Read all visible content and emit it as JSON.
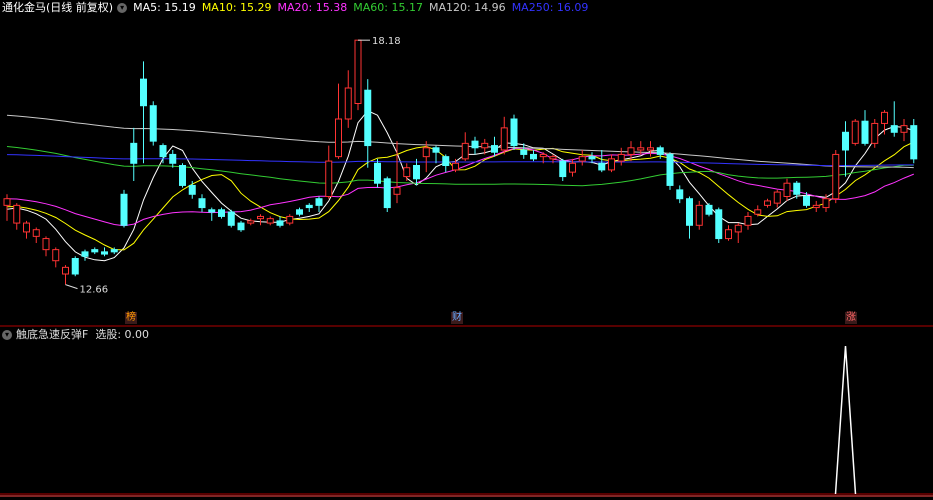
{
  "header": {
    "title": "通化金马(日线 前复权)",
    "ma_items": [
      {
        "label": "MA5: 15.19",
        "color": "#ffffff"
      },
      {
        "label": "MA10: 15.29",
        "color": "#ffff00"
      },
      {
        "label": "MA20: 15.38",
        "color": "#ff33ff"
      },
      {
        "label": "MA60: 15.17",
        "color": "#33cc33"
      },
      {
        "label": "MA120: 14.96",
        "color": "#c8c8c8"
      },
      {
        "label": "MA250: 16.09",
        "color": "#3333ff"
      }
    ]
  },
  "sub_panel": {
    "title": "触底急速反弹F",
    "value_label": "选股: 0.00"
  },
  "annotations": {
    "high_label": "18.18",
    "low_label": "12.66"
  },
  "tags": [
    {
      "text": "榜",
      "color": "#ff9900"
    },
    {
      "text": "财",
      "color": "#66aaff"
    },
    {
      "text": "涨",
      "color": "#ff6666"
    }
  ],
  "colors": {
    "up": "#ff3333",
    "down": "#54ffff",
    "border": "#b00000"
  },
  "chart_data": {
    "type": "candlestick",
    "price_range": [
      12.2,
      18.5
    ],
    "candles": [
      [
        14.45,
        14.6,
        14.1,
        14.7
      ],
      [
        14.05,
        14.45,
        13.9,
        14.5
      ],
      [
        13.85,
        14.05,
        13.7,
        14.1
      ],
      [
        13.75,
        13.9,
        13.6,
        13.95
      ],
      [
        13.45,
        13.7,
        13.3,
        13.75
      ],
      [
        13.2,
        13.45,
        13.05,
        13.5
      ],
      [
        12.9,
        13.05,
        12.66,
        13.1
      ],
      [
        13.25,
        12.9,
        12.85,
        13.3
      ],
      [
        13.4,
        13.3,
        13.2,
        13.45
      ],
      [
        13.45,
        13.4,
        13.35,
        13.5
      ],
      [
        13.4,
        13.35,
        13.3,
        13.5
      ],
      [
        13.45,
        13.4,
        13.35,
        13.5
      ],
      [
        14.7,
        14.0,
        13.95,
        14.8
      ],
      [
        15.85,
        15.4,
        15.0,
        16.2
      ],
      [
        17.3,
        16.7,
        15.4,
        17.7
      ],
      [
        16.7,
        15.9,
        15.8,
        16.8
      ],
      [
        15.8,
        15.55,
        15.4,
        15.85
      ],
      [
        15.6,
        15.4,
        15.3,
        15.7
      ],
      [
        15.35,
        14.9,
        14.85,
        15.4
      ],
      [
        14.9,
        14.7,
        14.6,
        15.0
      ],
      [
        14.6,
        14.4,
        14.3,
        14.7
      ],
      [
        14.35,
        14.3,
        14.1,
        14.4
      ],
      [
        14.35,
        14.2,
        14.15,
        14.4
      ],
      [
        14.3,
        14.0,
        13.95,
        14.35
      ],
      [
        14.05,
        13.9,
        13.85,
        14.1
      ],
      [
        14.05,
        14.1,
        14.0,
        14.15
      ],
      [
        14.15,
        14.2,
        14.0,
        14.25
      ],
      [
        14.05,
        14.15,
        14.0,
        14.2
      ],
      [
        14.1,
        14.0,
        13.95,
        14.2
      ],
      [
        14.05,
        14.2,
        14.0,
        14.25
      ],
      [
        14.35,
        14.25,
        14.2,
        14.4
      ],
      [
        14.45,
        14.4,
        14.3,
        14.5
      ],
      [
        14.6,
        14.45,
        14.3,
        14.65
      ],
      [
        14.65,
        15.45,
        14.6,
        15.8
      ],
      [
        15.55,
        16.4,
        15.5,
        17.2
      ],
      [
        16.4,
        17.1,
        16.2,
        17.5
      ],
      [
        16.75,
        18.18,
        16.6,
        18.18
      ],
      [
        17.05,
        15.8,
        15.3,
        17.3
      ],
      [
        15.4,
        14.95,
        14.85,
        15.5
      ],
      [
        15.05,
        14.4,
        14.3,
        15.1
      ],
      [
        14.7,
        14.85,
        14.5,
        15.9
      ],
      [
        15.1,
        15.3,
        15.0,
        15.4
      ],
      [
        15.35,
        15.05,
        14.9,
        15.5
      ],
      [
        15.55,
        15.75,
        15.2,
        15.9
      ],
      [
        15.75,
        15.65,
        15.4,
        15.8
      ],
      [
        15.55,
        15.35,
        15.2,
        15.6
      ],
      [
        15.25,
        15.4,
        15.2,
        15.5
      ],
      [
        15.5,
        15.85,
        15.45,
        16.1
      ],
      [
        15.9,
        15.75,
        15.6,
        16.0
      ],
      [
        15.75,
        15.85,
        15.6,
        15.95
      ],
      [
        15.8,
        15.65,
        15.55,
        16.0
      ],
      [
        15.7,
        16.2,
        15.6,
        16.45
      ],
      [
        16.4,
        15.8,
        15.7,
        16.5
      ],
      [
        15.7,
        15.6,
        15.5,
        15.85
      ],
      [
        15.6,
        15.5,
        15.45,
        15.7
      ],
      [
        15.55,
        15.6,
        15.4,
        15.65
      ],
      [
        15.5,
        15.55,
        15.4,
        15.6
      ],
      [
        15.45,
        15.1,
        15.0,
        15.5
      ],
      [
        15.2,
        15.4,
        15.1,
        15.5
      ],
      [
        15.45,
        15.55,
        15.35,
        15.7
      ],
      [
        15.55,
        15.5,
        15.4,
        15.65
      ],
      [
        15.4,
        15.25,
        15.2,
        15.7
      ],
      [
        15.25,
        15.5,
        15.2,
        15.6
      ],
      [
        15.45,
        15.6,
        15.35,
        15.75
      ],
      [
        15.6,
        15.75,
        15.45,
        15.9
      ],
      [
        15.7,
        15.75,
        15.6,
        15.9
      ],
      [
        15.7,
        15.75,
        15.55,
        15.9
      ],
      [
        15.75,
        15.6,
        15.5,
        15.8
      ],
      [
        15.6,
        14.9,
        14.8,
        15.65
      ],
      [
        14.8,
        14.6,
        14.5,
        14.9
      ],
      [
        14.6,
        14.0,
        13.7,
        14.65
      ],
      [
        14.0,
        14.45,
        13.9,
        14.55
      ],
      [
        14.45,
        14.25,
        14.2,
        14.5
      ],
      [
        14.35,
        13.7,
        13.6,
        14.4
      ],
      [
        13.7,
        13.9,
        13.65,
        14.0
      ],
      [
        13.85,
        14.0,
        13.6,
        14.05
      ],
      [
        14.0,
        14.2,
        13.9,
        14.3
      ],
      [
        14.25,
        14.35,
        14.2,
        14.45
      ],
      [
        14.45,
        14.55,
        14.4,
        14.6
      ],
      [
        14.5,
        14.75,
        14.4,
        14.8
      ],
      [
        14.65,
        14.95,
        14.55,
        15.05
      ],
      [
        14.95,
        14.7,
        14.6,
        15.0
      ],
      [
        14.65,
        14.45,
        14.4,
        14.75
      ],
      [
        14.4,
        14.45,
        14.3,
        14.55
      ],
      [
        14.4,
        14.6,
        14.3,
        14.7
      ],
      [
        14.6,
        15.6,
        14.5,
        15.7
      ],
      [
        16.1,
        15.7,
        15.1,
        16.35
      ],
      [
        15.85,
        16.35,
        15.8,
        16.4
      ],
      [
        16.35,
        15.85,
        15.8,
        16.6
      ],
      [
        15.85,
        16.3,
        15.75,
        16.4
      ],
      [
        16.3,
        16.55,
        16.05,
        16.6
      ],
      [
        16.25,
        16.1,
        16.0,
        16.8
      ],
      [
        16.1,
        16.25,
        15.9,
        16.4
      ],
      [
        16.25,
        15.5,
        15.4,
        16.4
      ]
    ],
    "signal_index": 86,
    "signal_range": [
      0,
      1
    ]
  }
}
